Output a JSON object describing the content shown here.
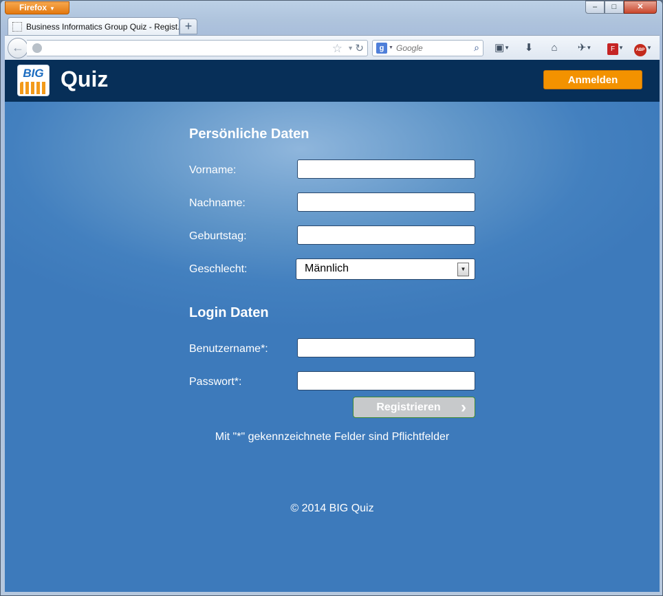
{
  "browser": {
    "app_button": "Firefox",
    "tab_title": "Business Informatics Group Quiz - Regist...",
    "new_tab": "+",
    "url": "",
    "search_placeholder": "Google",
    "window_controls": {
      "minimize": "–",
      "maximize": "□",
      "close": "✕"
    }
  },
  "header": {
    "logo_text": "BIG",
    "brand": "Quiz",
    "login_button": "Anmelden"
  },
  "personal": {
    "title": "Persönliche Daten",
    "firstname_label": "Vorname:",
    "lastname_label": "Nachname:",
    "birthday_label": "Geburtstag:",
    "gender_label": "Geschlecht:",
    "gender_value": "Männlich"
  },
  "login": {
    "title": "Login Daten",
    "username_label": "Benutzername*:",
    "password_label": "Passwort*:",
    "register_button": "Registrieren"
  },
  "note": "Mit \"*\" gekennzeichnete Felder sind Pflichtfelder",
  "footer": "© 2014 BIG Quiz",
  "colors": {
    "header_bg": "#072f58",
    "accent": "#f39200",
    "page_bg": "#4380bf"
  }
}
